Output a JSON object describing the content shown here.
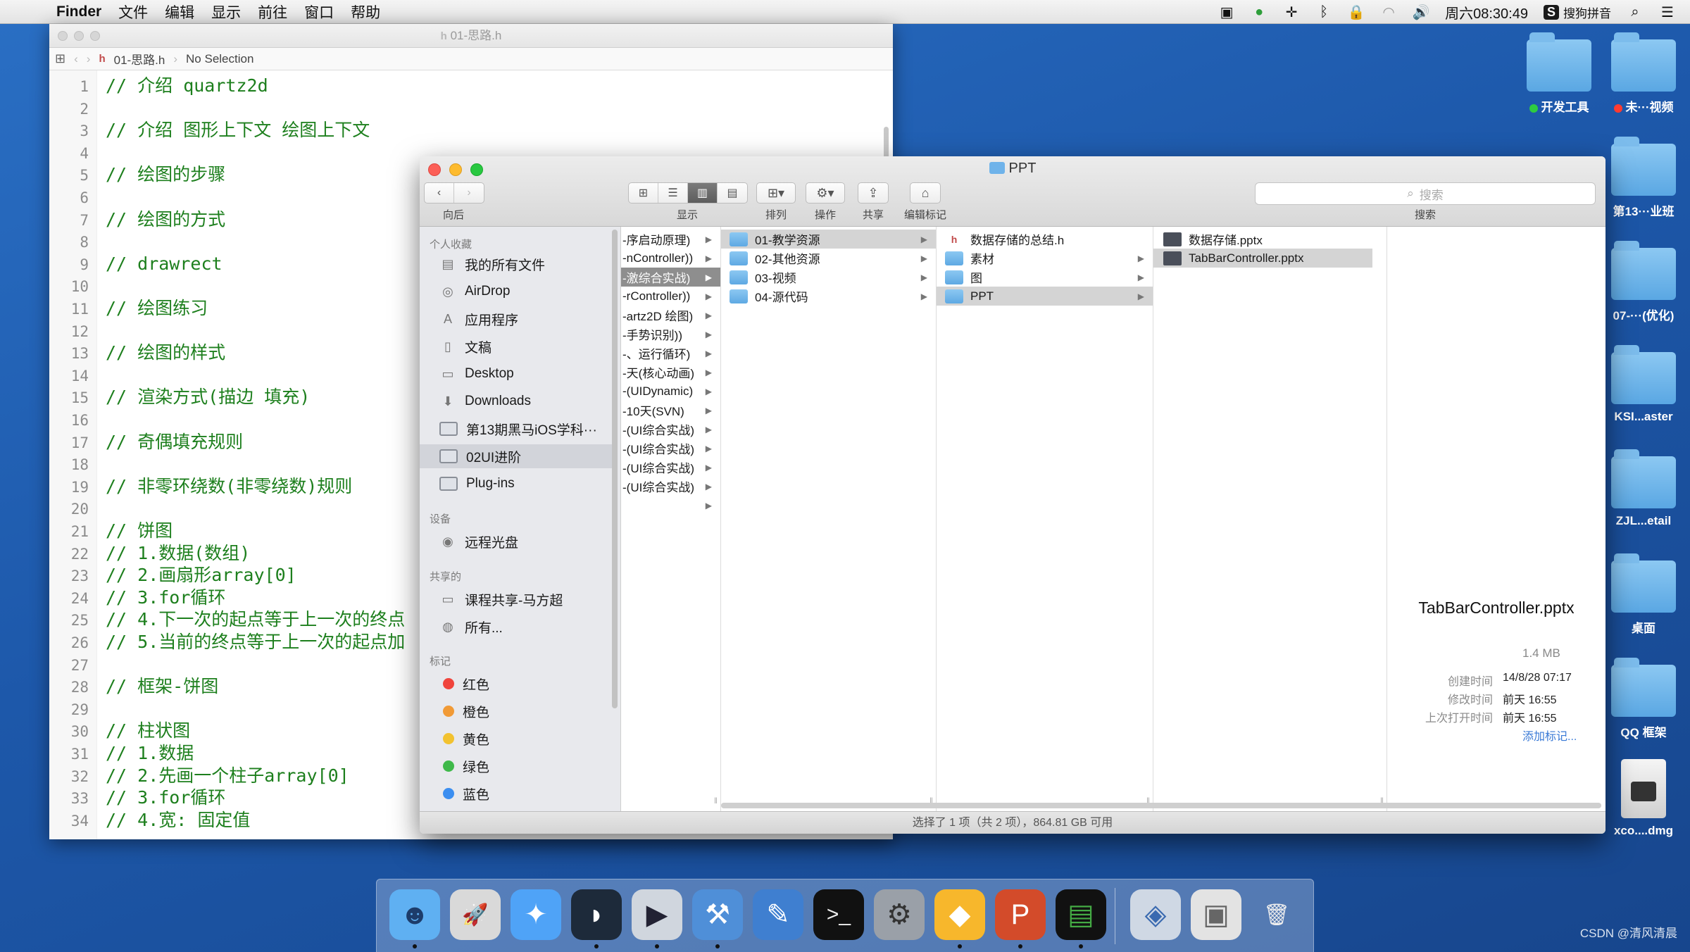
{
  "menubar": {
    "app": "Finder",
    "items": [
      "文件",
      "编辑",
      "显示",
      "前往",
      "窗口",
      "帮助"
    ],
    "clock": "周六08:30:49",
    "ime_badge": "S",
    "ime": "搜狗拼音"
  },
  "desktop": {
    "icons": [
      {
        "label": "开发工具",
        "tag": "#2ecc40"
      },
      {
        "label": "未···视频",
        "tag": "#ff3b30"
      },
      {
        "label": "第13···业班",
        "tag": ""
      },
      {
        "label": "07-···(优化)",
        "tag": ""
      },
      {
        "label": "KSI...aster",
        "tag": ""
      },
      {
        "label": "ZJL...etail",
        "tag": ""
      },
      {
        "label": "桌面",
        "tag": ""
      },
      {
        "label": "QQ 框架",
        "tag": ""
      },
      {
        "label": "xco....dmg",
        "tag": ""
      }
    ]
  },
  "xcode": {
    "title": "01-思路.h",
    "file_badge": "h",
    "breadcrumb_file": "01-思路.h",
    "breadcrumb_selection": "No Selection",
    "lines": [
      {
        "n": "1",
        "t": "// 介绍 quartz2d"
      },
      {
        "n": "2",
        "t": ""
      },
      {
        "n": "3",
        "t": "// 介绍 图形上下文 绘图上下文"
      },
      {
        "n": "4",
        "t": ""
      },
      {
        "n": "5",
        "t": "// 绘图的步骤"
      },
      {
        "n": "6",
        "t": ""
      },
      {
        "n": "7",
        "t": "// 绘图的方式"
      },
      {
        "n": "8",
        "t": ""
      },
      {
        "n": "9",
        "t": "// drawrect"
      },
      {
        "n": "10",
        "t": ""
      },
      {
        "n": "11",
        "t": "// 绘图练习"
      },
      {
        "n": "12",
        "t": ""
      },
      {
        "n": "13",
        "t": "// 绘图的样式"
      },
      {
        "n": "14",
        "t": ""
      },
      {
        "n": "15",
        "t": "// 渲染方式(描边 填充)"
      },
      {
        "n": "16",
        "t": ""
      },
      {
        "n": "17",
        "t": "// 奇偶填充规则"
      },
      {
        "n": "18",
        "t": ""
      },
      {
        "n": "19",
        "t": "// 非零环绕数(非零绕数)规则"
      },
      {
        "n": "20",
        "t": ""
      },
      {
        "n": "21",
        "t": "// 饼图"
      },
      {
        "n": "22",
        "t": "// 1.数据(数组)"
      },
      {
        "n": "23",
        "t": "// 2.画扇形array[0]"
      },
      {
        "n": "24",
        "t": "// 3.for循环"
      },
      {
        "n": "25",
        "t": "// 4.下一次的起点等于上一次的终点"
      },
      {
        "n": "26",
        "t": "// 5.当前的终点等于上一次的起点加"
      },
      {
        "n": "27",
        "t": ""
      },
      {
        "n": "28",
        "t": "// 框架-饼图"
      },
      {
        "n": "29",
        "t": ""
      },
      {
        "n": "30",
        "t": "// 柱状图"
      },
      {
        "n": "31",
        "t": "// 1.数据"
      },
      {
        "n": "32",
        "t": "// 2.先画一个柱子array[0]"
      },
      {
        "n": "33",
        "t": "// 3.for循环"
      },
      {
        "n": "34",
        "t": "// 4.宽: 固定值"
      }
    ]
  },
  "finder": {
    "title": "PPT",
    "toolbar": {
      "back_label": "向后",
      "view_label": "显示",
      "arrange_label": "排列",
      "action_label": "操作",
      "share_label": "共享",
      "tags_label": "编辑标记",
      "search_placeholder": "搜索",
      "search_label": "搜索"
    },
    "sidebar": {
      "favorites_header": "个人收藏",
      "favorites": [
        {
          "label": "我的所有文件",
          "icon": "all-files-icon",
          "glyph": "▤"
        },
        {
          "label": "AirDrop",
          "icon": "airdrop-icon",
          "glyph": "◎"
        },
        {
          "label": "应用程序",
          "icon": "applications-icon",
          "glyph": "A"
        },
        {
          "label": "文稿",
          "icon": "documents-icon",
          "glyph": "▯"
        },
        {
          "label": "Desktop",
          "icon": "desktop-icon",
          "glyph": "▭"
        },
        {
          "label": "Downloads",
          "icon": "downloads-icon",
          "glyph": "⬇"
        },
        {
          "label": "第13期黑马iOS学科···",
          "icon": "folder-icon",
          "glyph": ""
        },
        {
          "label": "02UI进阶",
          "icon": "folder-icon",
          "glyph": ""
        },
        {
          "label": "Plug-ins",
          "icon": "folder-icon",
          "glyph": ""
        }
      ],
      "devices_header": "设备",
      "devices": [
        {
          "label": "远程光盘",
          "icon": "remote-disc-icon",
          "glyph": "◉"
        }
      ],
      "shared_header": "共享的",
      "shared": [
        {
          "label": "课程共享-马方超",
          "icon": "computer-icon",
          "glyph": "▭"
        },
        {
          "label": "所有...",
          "icon": "network-icon",
          "glyph": "◍"
        }
      ],
      "tags_header": "标记",
      "tags": [
        {
          "label": "红色",
          "color": "#f0443c"
        },
        {
          "label": "橙色",
          "color": "#f19a36"
        },
        {
          "label": "黄色",
          "color": "#f2c230"
        },
        {
          "label": "绿色",
          "color": "#3fb94a"
        },
        {
          "label": "蓝色",
          "color": "#3b8ef0"
        }
      ]
    },
    "columns": {
      "col1": [
        "-序启动原理)",
        "-nController))",
        "-激综合实战)",
        "-rController))",
        "-artz2D 绘图)",
        "-手势识别))",
        "-、运行循环)",
        "-天(核心动画)",
        "-(UIDynamic)",
        "-10天(SVN)",
        "-(UI综合实战)",
        "-(UI综合实战)",
        "-(UI综合实战)",
        "-(UI综合实战)",
        ""
      ],
      "col2": [
        "01-教学资源",
        "02-其他资源",
        "03-视频",
        "04-源代码"
      ],
      "col3": [
        {
          "label": "数据存储的总结.h",
          "kind": "h"
        },
        {
          "label": "素材",
          "kind": "folder"
        },
        {
          "label": "图",
          "kind": "folder"
        },
        {
          "label": "PPT",
          "kind": "folder"
        }
      ],
      "col4": [
        "数据存储.pptx",
        "TabBarController.pptx"
      ]
    },
    "preview": {
      "name": "TabBarController.pptx",
      "size": "1.4 MB",
      "created_label": "创建时间",
      "created": "14/8/28 07:17",
      "modified_label": "修改时间",
      "modified": "前天 16:55",
      "opened_label": "上次打开时间",
      "opened": "前天 16:55",
      "add_tags": "添加标记..."
    },
    "status": "选择了 1 项（共 2 项），864.81 GB 可用"
  },
  "dock": {
    "apps": [
      {
        "name": "finder-icon",
        "glyph": "☻",
        "bg": "#5fb0f2",
        "fg": "#1d3c6a",
        "running": true
      },
      {
        "name": "launchpad-icon",
        "glyph": "🚀",
        "bg": "#d9d9d9",
        "fg": "#555",
        "running": false
      },
      {
        "name": "safari-icon",
        "glyph": "✦",
        "bg": "#4fa3f7",
        "fg": "#fff",
        "running": false
      },
      {
        "name": "mouse-utility-icon",
        "glyph": "◗",
        "bg": "#1d2a3a",
        "fg": "#fff",
        "running": true
      },
      {
        "name": "video-app-icon",
        "glyph": "▶",
        "bg": "#d0d6de",
        "fg": "#223",
        "running": true
      },
      {
        "name": "xcode-icon",
        "glyph": "⚒",
        "bg": "#4f8fd8",
        "fg": "#fff",
        "running": true
      },
      {
        "name": "instruments-icon",
        "glyph": "✎",
        "bg": "#3f7fd0",
        "fg": "#fff",
        "running": false
      },
      {
        "name": "terminal-icon",
        "glyph": ">_",
        "bg": "#111",
        "fg": "#eee",
        "running": false
      },
      {
        "name": "system-preferences-icon",
        "glyph": "⚙",
        "bg": "#9aa0a8",
        "fg": "#333",
        "running": false
      },
      {
        "name": "sketch-icon",
        "glyph": "◆",
        "bg": "#f7b72c",
        "fg": "#fff",
        "running": true
      },
      {
        "name": "powerpoint-icon",
        "glyph": "P",
        "bg": "#d34b2a",
        "fg": "#fff",
        "running": true
      },
      {
        "name": "console-icon",
        "glyph": "▤",
        "bg": "#111",
        "fg": "#4a4",
        "running": true
      },
      {
        "name": "preview-icon",
        "glyph": "◈",
        "bg": "#cfd8e4",
        "fg": "#3a6ab0",
        "running": false
      },
      {
        "name": "photo-browser-icon",
        "glyph": "▣",
        "bg": "#e3e3e3",
        "fg": "#666",
        "running": false
      },
      {
        "name": "trash-icon",
        "glyph": "🗑",
        "bg": "transparent",
        "fg": "#eee",
        "running": false
      }
    ]
  },
  "watermark": "CSDN @清风清晨"
}
